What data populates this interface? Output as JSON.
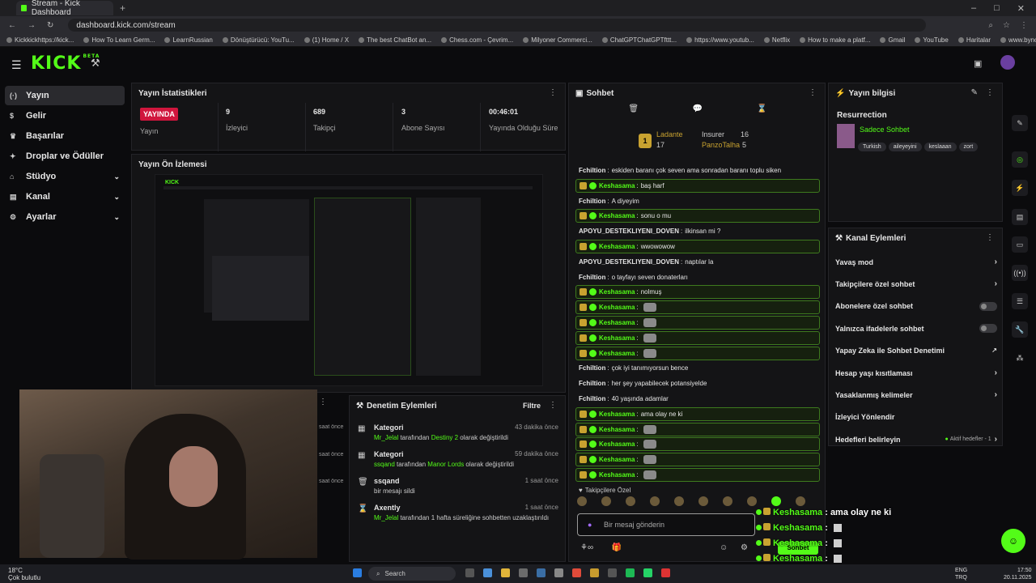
{
  "browser": {
    "tab_title": "Stream - Kick Dashboard",
    "url": "dashboard.kick.com/stream",
    "bookmarks": [
      "Kickkickhttps://kick...",
      "How To Learn Germ...",
      "LearnRussian",
      "Dönüştürücü: YouTu...",
      "(1) Home / X",
      "The best ChatBot an...",
      "Chess.com - Çevrim...",
      "Milyoner Commerci...",
      "ChatGPTChatGPTfttt...",
      "https://www.youtub...",
      "Netflix",
      "How to make a platf...",
      "Gmail",
      "YouTube",
      "Haritalar",
      "www.bynogame.co...",
      "@sologesang - TFT...",
      "Tüm Yer İşaretleri"
    ]
  },
  "header": {
    "logo": "KICK",
    "logo_sup": "BETA"
  },
  "sidebar": {
    "items": [
      {
        "label": "Yayın",
        "icon": "broadcast-icon"
      },
      {
        "label": "Gelir",
        "icon": "dollar-icon"
      },
      {
        "label": "Başarılar",
        "icon": "trophy-icon"
      },
      {
        "label": "Droplar ve Ödüller",
        "icon": "gift-icon"
      },
      {
        "label": "Stüdyo",
        "icon": "studio-icon"
      },
      {
        "label": "Kanal",
        "icon": "channel-icon"
      },
      {
        "label": "Ayarlar",
        "icon": "gear-icon"
      }
    ]
  },
  "stats": {
    "title": "Yayın İstatistikleri",
    "live_badge": "YAYINDA",
    "live_label": "Yayın",
    "viewers": "9",
    "viewers_label": "İzleyici",
    "followers": "689",
    "followers_label": "Takipçi",
    "subs": "3",
    "subs_label": "Abone Sayısı",
    "duration": "00:46:01",
    "duration_label": "Yayında Olduğu Süre"
  },
  "preview": {
    "title": "Yayın Ön İzlemesi"
  },
  "moderation": {
    "title": "Denetim Eylemleri",
    "filter": "Filtre",
    "items": [
      {
        "head": "Kategori",
        "user": "Mr_Jelal",
        "mid": " tarafından ",
        "target": "Destiny 2",
        "tail": " olarak değiştirildi",
        "time": "43 dakika önce"
      },
      {
        "head": "Kategori",
        "user": "ssqand",
        "mid": " tarafından ",
        "target": "Manor Lords",
        "tail": " olarak değiştirildi",
        "time": "59 dakika önce"
      },
      {
        "head": "ssqand",
        "user": "",
        "mid": "bir mesajı sildi",
        "target": "",
        "tail": "",
        "time": "1 saat önce"
      },
      {
        "head": "Axently",
        "user": "Mr_Jelal",
        "mid": " tarafından 1 hafta süreliğine sohbetten uzaklaştırıldı",
        "target": "",
        "tail": "",
        "time": "1 saat önce"
      }
    ],
    "left_times": [
      "saat önce",
      "saat önce",
      "saat önce"
    ]
  },
  "chat": {
    "title": "Sohbet",
    "leader1_name": "Ladante",
    "leader1_count": "17",
    "leader2_name": "Insurer",
    "leader2_count": "16",
    "leader3_name": "PanzoTalha",
    "leader3_count": "5",
    "rank": "1",
    "messages": [
      {
        "user": "Fchiltion",
        "text": "eskiden baranı çok seven ama sonradan baranı toplu siken",
        "hl": false
      },
      {
        "user": "Keshasama",
        "text": "baş harf",
        "hl": true
      },
      {
        "user": "Fchiltion",
        "text": "A diyeyim",
        "hl": false
      },
      {
        "user": "Keshasama",
        "text": "sonu o mu",
        "hl": true
      },
      {
        "user": "APOYU_DESTEKLIYENI_DOVEN",
        "text": "ilkinsan mi ?",
        "hl": false
      },
      {
        "user": "Keshasama",
        "text": "wwowowow",
        "hl": true
      },
      {
        "user": "APOYU_DESTEKLIYENI_DOVEN",
        "text": "naptılar la",
        "hl": false
      },
      {
        "user": "Fchiltion",
        "text": "o tayfayı seven donaterları",
        "hl": false
      },
      {
        "user": "Keshasama",
        "text": "nolmuş",
        "hl": true
      },
      {
        "user": "Keshasama",
        "text": "",
        "hl": true,
        "emote": true
      },
      {
        "user": "Keshasama",
        "text": "",
        "hl": true,
        "emote": true
      },
      {
        "user": "Keshasama",
        "text": "",
        "hl": true,
        "emote": true
      },
      {
        "user": "Keshasama",
        "text": "",
        "hl": true,
        "emote": true
      },
      {
        "user": "Fchiltion",
        "text": "çok iyi tanımıyorsun bence",
        "hl": false
      },
      {
        "user": "Fchiltion",
        "text": "her şey yapabilecek potansiyelde",
        "hl": false
      },
      {
        "user": "Fchiltion",
        "text": "40 yaşında adamlar",
        "hl": false
      },
      {
        "user": "Keshasama",
        "text": "ama olay ne ki",
        "hl": true
      },
      {
        "user": "Keshasama",
        "text": "",
        "hl": true,
        "emote": true
      },
      {
        "user": "Keshasama",
        "text": "",
        "hl": true,
        "emote": true
      },
      {
        "user": "Keshasama",
        "text": "",
        "hl": true,
        "emote": true
      },
      {
        "user": "Keshasama",
        "text": "",
        "hl": true,
        "emote": true
      }
    ],
    "followers_only": "Takipçilere Özel",
    "placeholder": "Bir mesaj gönderin",
    "send": "Sohbet"
  },
  "info": {
    "title": "Yayın bilgisi",
    "stream_title": "Resurrection",
    "category": "Sadece Sohbet",
    "tags": [
      "Turkish",
      "aileyeyini",
      "keslaaan",
      "zort"
    ]
  },
  "actions": {
    "title": "Kanal Eylemleri",
    "items": [
      {
        "label": "Yavaş mod",
        "kind": "arrow"
      },
      {
        "label": "Takipçilere özel sohbet",
        "kind": "arrow"
      },
      {
        "label": "Abonelere özel sohbet",
        "kind": "toggle"
      },
      {
        "label": "Yalnızca ifadelerle sohbet",
        "kind": "toggle"
      },
      {
        "label": "Yapay Zeka ile Sohbet Denetimi",
        "kind": "ext"
      },
      {
        "label": "Hesap yaşı kısıtlaması",
        "kind": "arrow"
      },
      {
        "label": "Yasaklanmış kelimeler",
        "kind": "arrow"
      },
      {
        "label": "İzleyici Yönlendir",
        "kind": "none"
      },
      {
        "label": "Hedefleri belirleyin",
        "kind": "goal"
      }
    ],
    "goal_status": "Aktif hedefler - 1"
  },
  "overlay": [
    {
      "name": "Keshasama",
      "text": "ama olay ne ki"
    },
    {
      "name": "Keshasama",
      "text": ""
    },
    {
      "name": "Keshasama",
      "text": ""
    },
    {
      "name": "Keshasama",
      "text": ""
    },
    {
      "name": "Keshasama",
      "text": ""
    }
  ],
  "taskbar": {
    "temp": "18°C",
    "weather": "Çok bulutlu",
    "search": "Search",
    "lang1": "ENG",
    "lang2": "TRQ",
    "time": "17:50",
    "date": "20.11.2025"
  },
  "colors": {
    "accent": "#53fc18",
    "live": "#d0163d",
    "panel": "#141416"
  }
}
